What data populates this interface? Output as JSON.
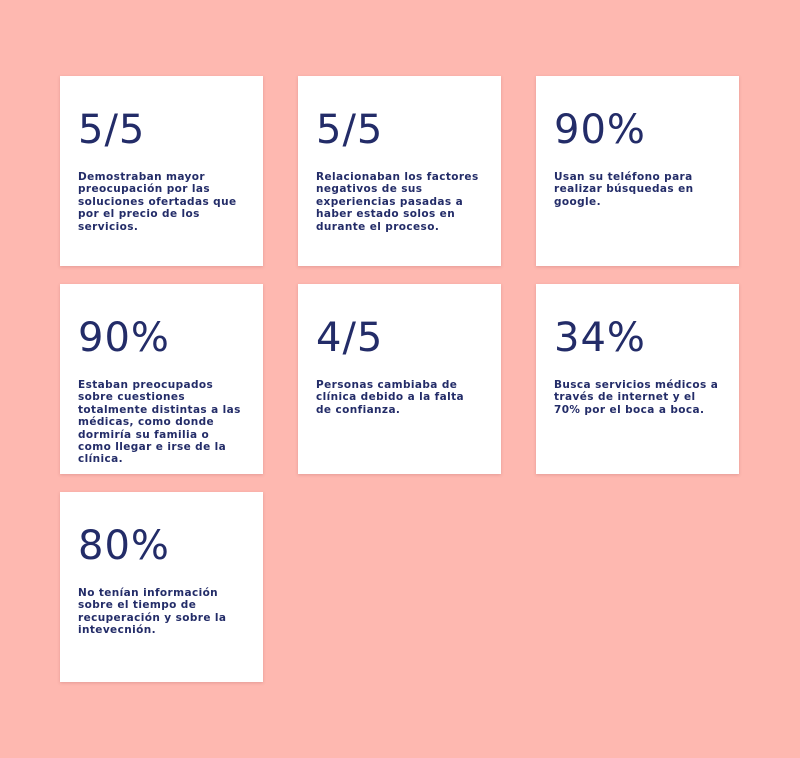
{
  "colors": {
    "background": "#FEB8B0",
    "card": "#FFFFFF",
    "text": "#232C68"
  },
  "cards": [
    {
      "stat": "5/5",
      "text": "Demostraban mayor preocupación por las soluciones ofertadas que por el precio de los servicios."
    },
    {
      "stat": "5/5",
      "text": "Relacionaban los factores negativos de sus experiencias pasadas a haber estado solos en durante el proceso."
    },
    {
      "stat": "90%",
      "text": "Usan su teléfono para realizar búsquedas en google."
    },
    {
      "stat": "90%",
      "text": "Estaban preocupados sobre cuestiones totalmente distintas a las médicas, como donde dormiría su familia o como llegar e irse de la clínica."
    },
    {
      "stat": "4/5",
      "text": "Personas cambiaba de clínica debido a la falta de confianza."
    },
    {
      "stat": "34%",
      "text": "Busca servicios médicos a través de internet y el 70% por el boca a boca."
    },
    {
      "stat": "80%",
      "text": "No tenían información sobre el tiempo de recuperación y sobre la intevecnión."
    }
  ]
}
